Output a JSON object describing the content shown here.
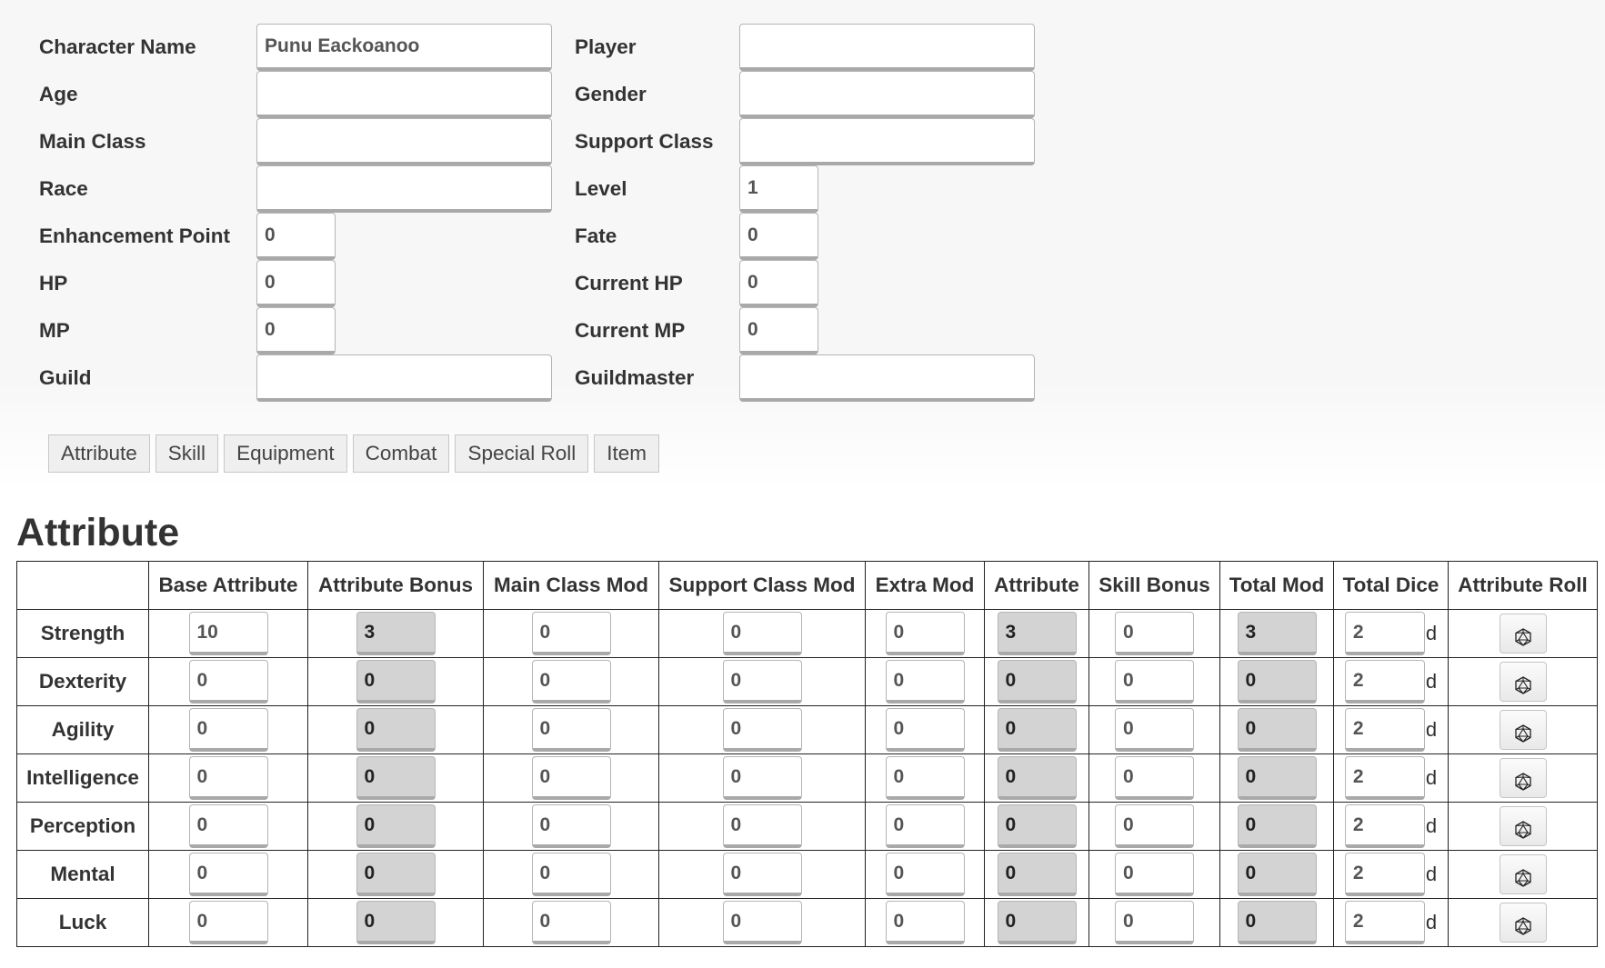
{
  "character": {
    "rows": [
      {
        "left_label": "Character Name",
        "left_value": "Punu Eackoanoo",
        "right_label": "Player",
        "right_value": ""
      },
      {
        "left_label": "Age",
        "left_value": "",
        "right_label": "Gender",
        "right_value": ""
      },
      {
        "left_label": "Main Class",
        "left_value": "",
        "right_label": "Support Class",
        "right_value": ""
      },
      {
        "left_label": "Race",
        "left_value": "",
        "right_label": "Level",
        "right_value": "1"
      },
      {
        "left_label": "Enhancement Point",
        "left_value": "0",
        "right_label": "Fate",
        "right_value": "0"
      },
      {
        "left_label": "HP",
        "left_value": "0",
        "right_label": "Current HP",
        "right_value": "0"
      },
      {
        "left_label": "MP",
        "left_value": "0",
        "right_label": "Current MP",
        "right_value": "0"
      },
      {
        "left_label": "Guild",
        "left_value": "",
        "right_label": "Guildmaster",
        "right_value": ""
      }
    ]
  },
  "tabs": [
    "Attribute",
    "Skill",
    "Equipment",
    "Combat",
    "Special Roll",
    "Item"
  ],
  "section_title": "Attribute",
  "attribute_table": {
    "columns": [
      "",
      "Base Attribute",
      "Attribute Bonus",
      "Main Class Mod",
      "Support Class Mod",
      "Extra Mod",
      "Attribute",
      "Skill Bonus",
      "Total Mod",
      "Total Dice",
      "Attribute Roll"
    ],
    "dice_suffix": "d",
    "roll_icon": "d20-dice-icon",
    "rows": [
      {
        "name": "Strength",
        "base": "10",
        "bonus": "3",
        "main_mod": "0",
        "support_mod": "0",
        "extra_mod": "0",
        "attribute": "3",
        "skill_bonus": "0",
        "total_mod": "3",
        "total_dice": "2"
      },
      {
        "name": "Dexterity",
        "base": "0",
        "bonus": "0",
        "main_mod": "0",
        "support_mod": "0",
        "extra_mod": "0",
        "attribute": "0",
        "skill_bonus": "0",
        "total_mod": "0",
        "total_dice": "2"
      },
      {
        "name": "Agility",
        "base": "0",
        "bonus": "0",
        "main_mod": "0",
        "support_mod": "0",
        "extra_mod": "0",
        "attribute": "0",
        "skill_bonus": "0",
        "total_mod": "0",
        "total_dice": "2"
      },
      {
        "name": "Intelligence",
        "base": "0",
        "bonus": "0",
        "main_mod": "0",
        "support_mod": "0",
        "extra_mod": "0",
        "attribute": "0",
        "skill_bonus": "0",
        "total_mod": "0",
        "total_dice": "2"
      },
      {
        "name": "Perception",
        "base": "0",
        "bonus": "0",
        "main_mod": "0",
        "support_mod": "0",
        "extra_mod": "0",
        "attribute": "0",
        "skill_bonus": "0",
        "total_mod": "0",
        "total_dice": "2"
      },
      {
        "name": "Mental",
        "base": "0",
        "bonus": "0",
        "main_mod": "0",
        "support_mod": "0",
        "extra_mod": "0",
        "attribute": "0",
        "skill_bonus": "0",
        "total_mod": "0",
        "total_dice": "2"
      },
      {
        "name": "Luck",
        "base": "0",
        "bonus": "0",
        "main_mod": "0",
        "support_mod": "0",
        "extra_mod": "0",
        "attribute": "0",
        "skill_bonus": "0",
        "total_mod": "0",
        "total_dice": "2"
      }
    ]
  }
}
